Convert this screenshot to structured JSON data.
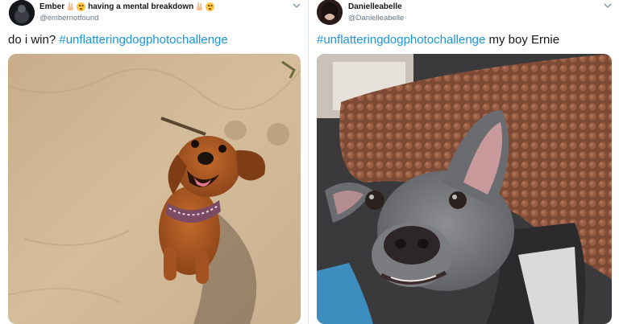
{
  "tweets": [
    {
      "display_name": "Ember",
      "name_suffix": "having a mental breakdown",
      "handle": "@embernotfound",
      "text_plain": "do i win? ",
      "hashtag": "#unflatteringdogphotochallenge",
      "text_after": "",
      "media_description_icon": "dachshund-photo"
    },
    {
      "display_name": "Danielleabelle",
      "name_suffix": "",
      "handle": "@Danielleabelle",
      "text_plain": "",
      "hashtag": "#unflatteringdogphotochallenge",
      "text_after": " my boy Ernie",
      "media_description_icon": "greyhound-photo"
    }
  ],
  "colors": {
    "hashtag": "#1b95e0",
    "handle": "#657786",
    "text": "#14171a"
  },
  "icons": {
    "more": "chevron-down-icon",
    "name_emoji_1": "victory-hand-icon",
    "name_emoji_2": "hushed-face-icon"
  }
}
